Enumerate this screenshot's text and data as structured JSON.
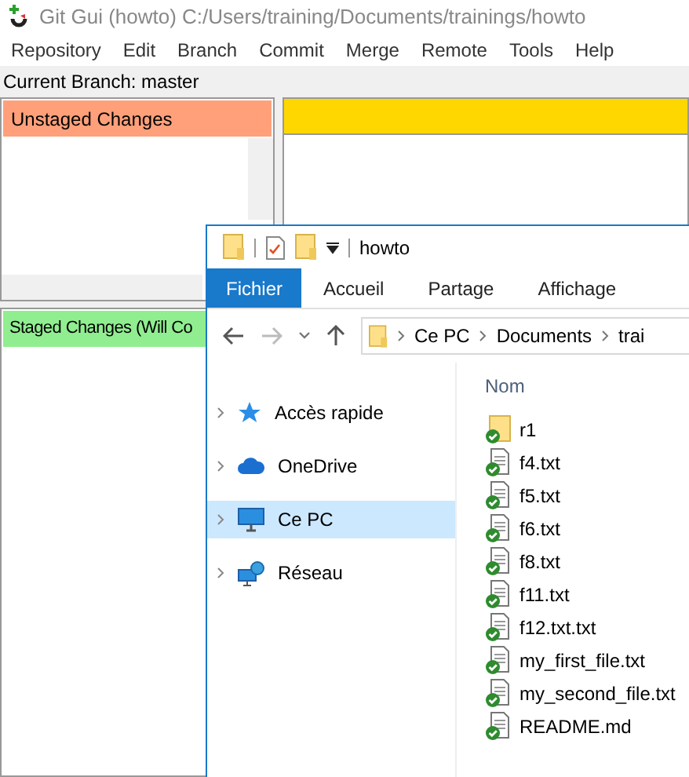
{
  "git_gui": {
    "title": "Git Gui (howto) C:/Users/training/Documents/trainings/howto",
    "menu": [
      "Repository",
      "Edit",
      "Branch",
      "Commit",
      "Merge",
      "Remote",
      "Tools",
      "Help"
    ],
    "current_branch": "Current Branch: master",
    "unstaged_header": "Unstaged Changes",
    "staged_header": "Staged Changes (Will Co"
  },
  "explorer": {
    "title": "howto",
    "ribbon_tabs": [
      {
        "label": "Fichier",
        "selected": true
      },
      {
        "label": "Accueil",
        "selected": false
      },
      {
        "label": "Partage",
        "selected": false
      },
      {
        "label": "Affichage",
        "selected": false
      }
    ],
    "breadcrumb": [
      "Ce PC",
      "Documents",
      "trai"
    ],
    "nav": [
      {
        "label": "Accès rapide",
        "kind": "star",
        "selected": false
      },
      {
        "label": "OneDrive",
        "kind": "cloud",
        "selected": false
      },
      {
        "label": "Ce PC",
        "kind": "computer",
        "selected": true
      },
      {
        "label": "Réseau",
        "kind": "network",
        "selected": false
      }
    ],
    "column": "Nom",
    "files": [
      {
        "name": "r1",
        "kind": "folder"
      },
      {
        "name": "f4.txt",
        "kind": "file"
      },
      {
        "name": "f5.txt",
        "kind": "file"
      },
      {
        "name": "f6.txt",
        "kind": "file"
      },
      {
        "name": "f8.txt",
        "kind": "file"
      },
      {
        "name": "f11.txt",
        "kind": "file"
      },
      {
        "name": "f12.txt.txt",
        "kind": "file"
      },
      {
        "name": "my_first_file.txt",
        "kind": "file"
      },
      {
        "name": "my_second_file.txt",
        "kind": "file"
      },
      {
        "name": "README.md",
        "kind": "file"
      }
    ]
  }
}
